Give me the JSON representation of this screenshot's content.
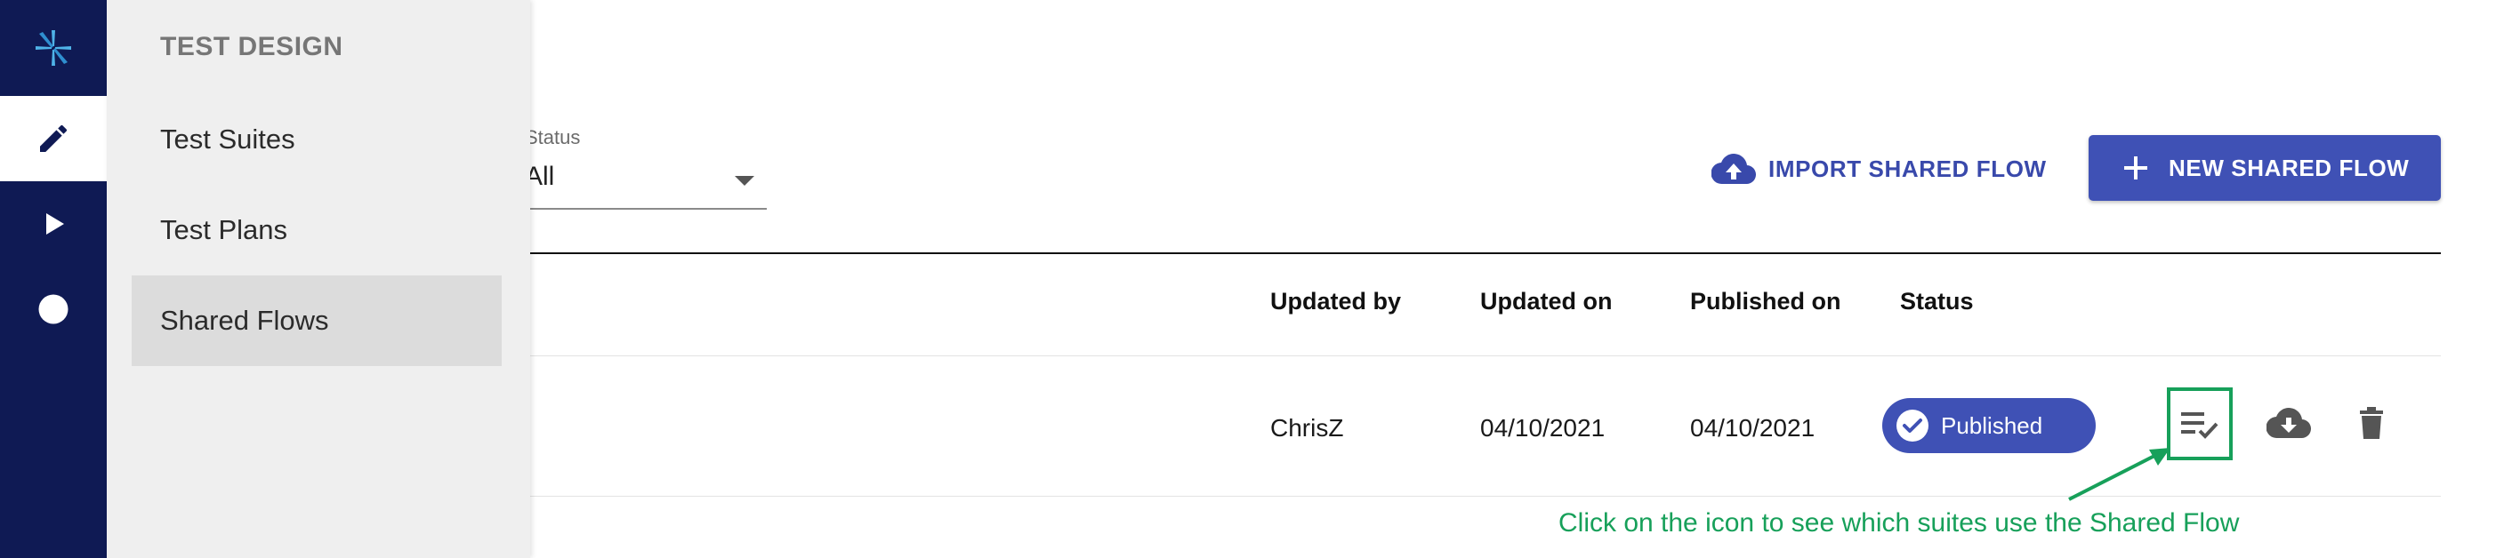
{
  "menu": {
    "title": "TEST DESIGN",
    "items": [
      {
        "label": "Test Suites"
      },
      {
        "label": "Test Plans"
      },
      {
        "label": "Shared Flows"
      }
    ]
  },
  "filter": {
    "label": "Status",
    "value": "All"
  },
  "actions": {
    "import_label": "IMPORT SHARED FLOW",
    "new_label": "NEW SHARED FLOW"
  },
  "table": {
    "columns": [
      "Updated by",
      "Updated on",
      "Published on",
      "Status"
    ],
    "rows": [
      {
        "updated_by": "ChrisZ",
        "updated_on": "04/10/2021",
        "published_on": "04/10/2021",
        "status": "Published"
      }
    ]
  },
  "annotation": "Click on the icon to see which suites use the Shared Flow",
  "colors": {
    "rail": "#0f1a54",
    "primary": "#3f51b5",
    "annotation": "#17a05a",
    "menu_bg": "#efefef"
  },
  "icons": [
    "app-logo-icon",
    "pencil-icon",
    "play-icon",
    "circle-icon",
    "cloud-upload-icon",
    "plus-icon",
    "check-circle-icon",
    "playlist-check-icon",
    "cloud-download-icon",
    "trash-icon",
    "arrow-icon"
  ]
}
